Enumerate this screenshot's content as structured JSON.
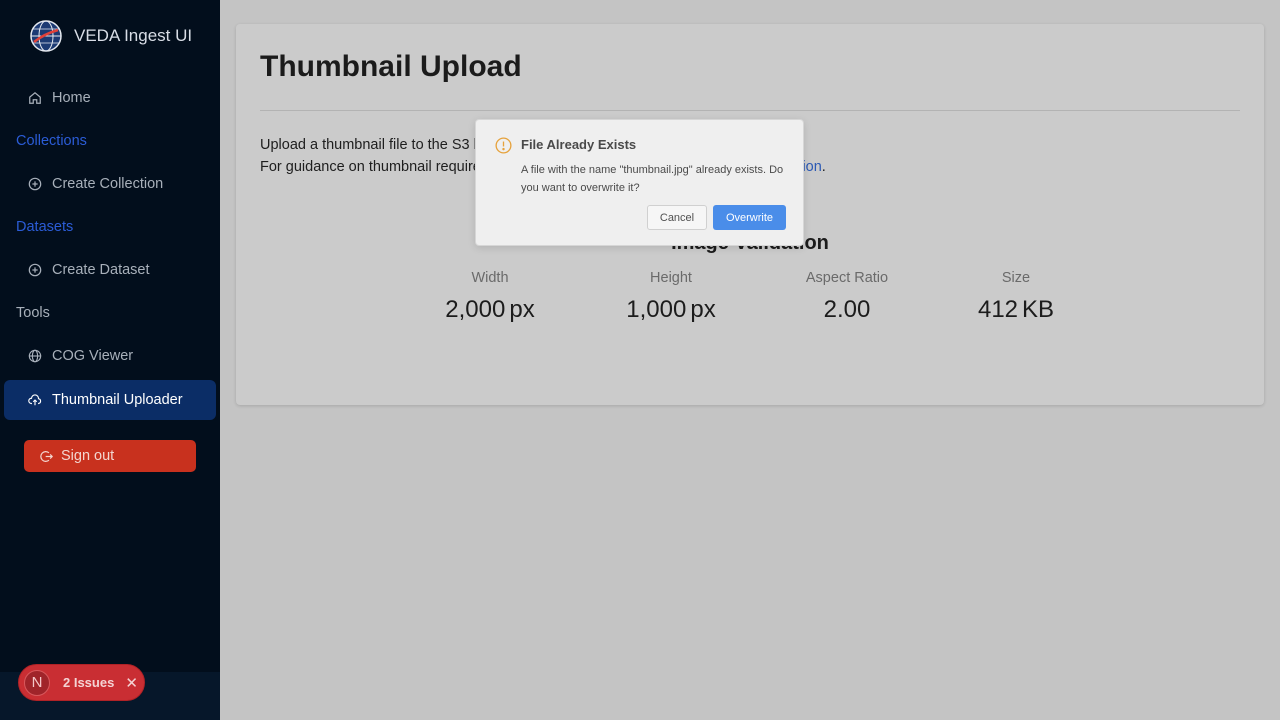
{
  "sidebar": {
    "brand": "VEDA Ingest UI",
    "home": "Home",
    "collections_section": "Collections",
    "create_collection": "Create Collection",
    "datasets_section": "Datasets",
    "create_dataset": "Create Dataset",
    "tools_section": "Tools",
    "cog_viewer": "COG Viewer",
    "thumbnail_uploader": "Thumbnail Uploader",
    "sign_out": "Sign out"
  },
  "issues_badge": {
    "letter": "N",
    "label": "2 Issues",
    "close": "✕"
  },
  "main": {
    "title": "Thumbnail Upload",
    "description_line1": "Upload a thumbnail file to the S3 bucket.",
    "description_line2_prefix": "For guidance on thumbnail requirements and best practices, refer to the ",
    "description_link": "Documentation",
    "description_line2_suffix": ".",
    "validation_title": "Image Validation",
    "metrics": [
      {
        "label": "Width",
        "value": "2,000",
        "unit": "px"
      },
      {
        "label": "Height",
        "value": "1,000",
        "unit": "px"
      },
      {
        "label": "Aspect Ratio",
        "value": "2.00",
        "unit": ""
      },
      {
        "label": "Size",
        "value": "412",
        "unit": "KB"
      }
    ]
  },
  "dialog": {
    "title": "File Already Exists",
    "message": "A file with the name \"thumbnail.jpg\" already exists. Do you want to overwrite it?",
    "cancel_label": "Cancel",
    "overwrite_label": "Overwrite"
  },
  "colors": {
    "sidebar_bg": "#020e1c",
    "active_nav": "#0b2d66",
    "link": "#2b5cd6",
    "signout": "#c8311e",
    "primary_button": "#4a8de9",
    "warning_icon": "#e6a23c"
  }
}
